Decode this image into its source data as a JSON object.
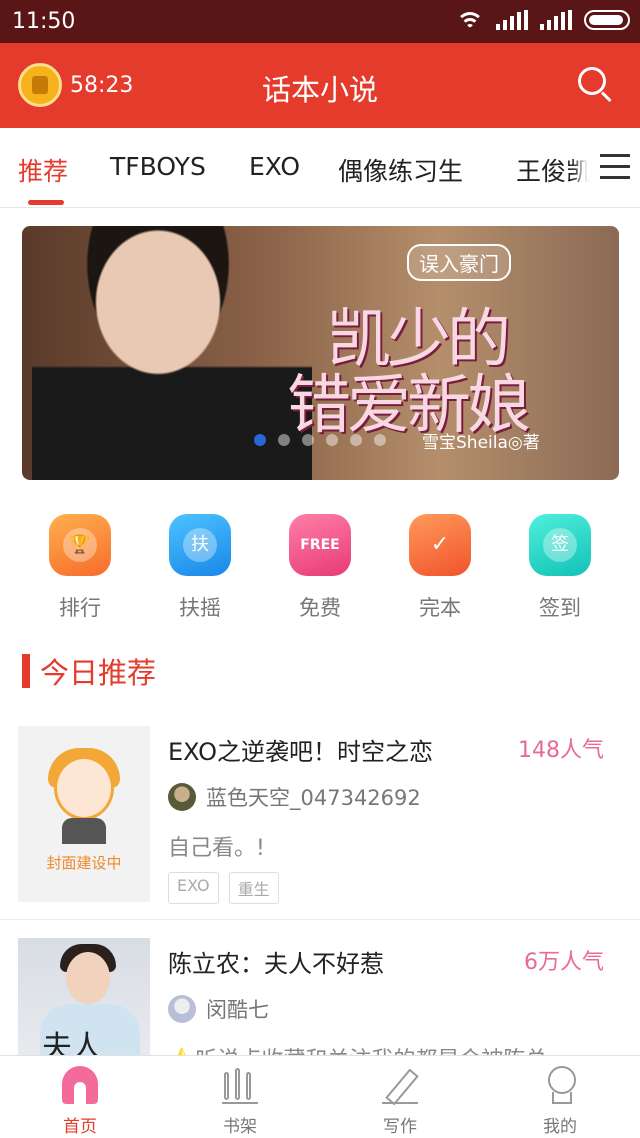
{
  "status_bar": {
    "time": "11:50",
    "battery_level": 0.95
  },
  "header": {
    "timer": "58:23",
    "title": "话本小说"
  },
  "tabs": [
    {
      "label": "推荐",
      "active": true
    },
    {
      "label": "TFBOYS"
    },
    {
      "label": "EXO"
    },
    {
      "label": "偶像练习生"
    },
    {
      "label": "王俊凯"
    }
  ],
  "banner": {
    "tag": "误入豪门",
    "title_line1": "凯少的",
    "title_line2": "错爱新娘",
    "author": "雪宝Sheila◎著",
    "active_slide": 1,
    "slide_count": 6
  },
  "quick_actions": [
    {
      "label": "排行",
      "icon": "trophy-icon",
      "glyph": "",
      "color": "#fb8a3c"
    },
    {
      "label": "扶摇",
      "icon": "fuyao-icon",
      "glyph": "扶",
      "color": "#2aa6f0"
    },
    {
      "label": "免费",
      "icon": "free-icon",
      "glyph": "FREE",
      "color": "#f0558b"
    },
    {
      "label": "完本",
      "icon": "check-icon",
      "glyph": "✓",
      "color": "#f76b3c"
    },
    {
      "label": "签到",
      "icon": "signin-icon",
      "glyph": "签",
      "color": "#1cd6c6"
    }
  ],
  "section": {
    "title": "今日推荐"
  },
  "books": [
    {
      "title": "EXO之逆袭吧！时空之恋",
      "popularity": "148人气",
      "author": "蓝色天空_047342692",
      "desc": "自己看。!",
      "tags": [
        "EXO",
        "重生"
      ],
      "cover_label": "封面建设中"
    },
    {
      "title": "陈立农：夫人不好惹",
      "popularity": "6万人气",
      "author": "闵酷七",
      "desc": "⭐听说点收藏和关注我的都是会被陈总",
      "tags": [],
      "cover_text": "夫人"
    }
  ],
  "bottom_nav": [
    {
      "label": "首页",
      "active": true
    },
    {
      "label": "书架"
    },
    {
      "label": "写作"
    },
    {
      "label": "我的"
    }
  ]
}
